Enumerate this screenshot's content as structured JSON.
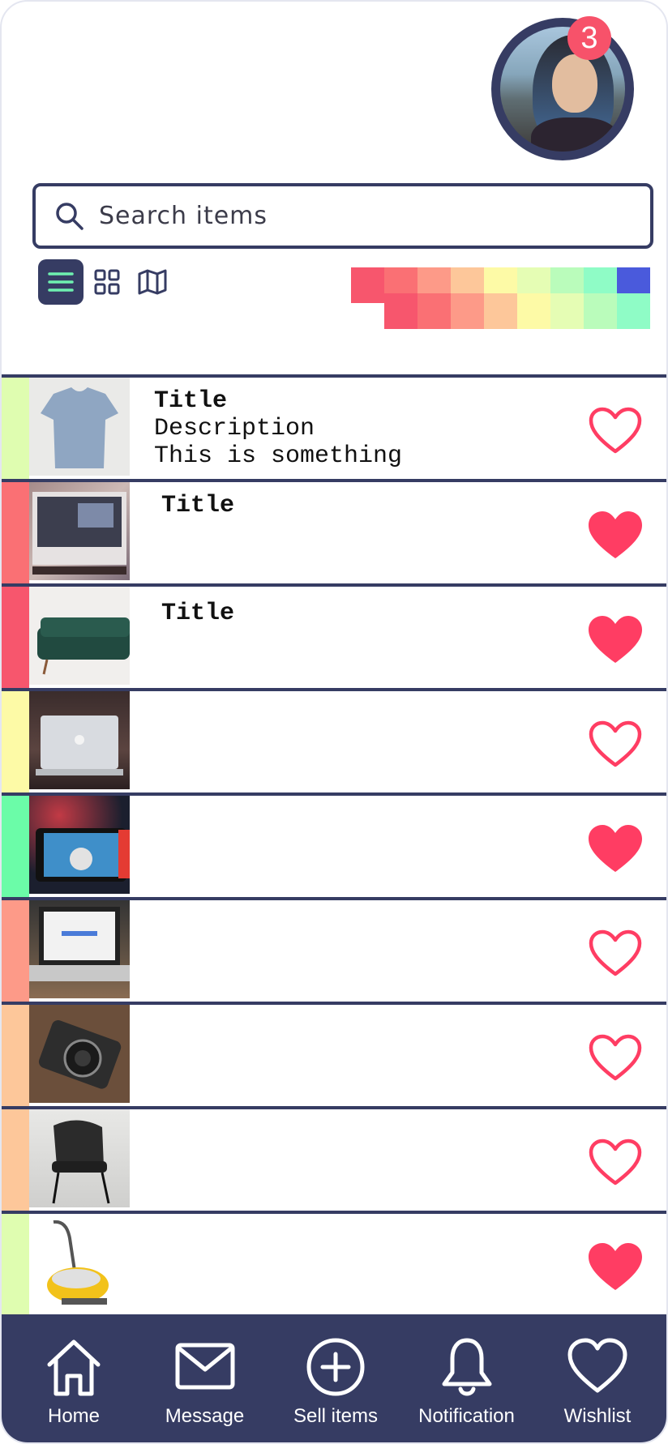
{
  "profile": {
    "notification_count": "3"
  },
  "search": {
    "placeholder": "Search items"
  },
  "view_modes": [
    "list",
    "grid",
    "map"
  ],
  "palette": {
    "row1": [
      "#f7566d",
      "#fa7074",
      "#fd9a88",
      "#fdc79a",
      "#fdfaa6",
      "#e5fdb4",
      "#bafcbb",
      "#8ffcc6",
      "#4a5adc"
    ],
    "row2": [
      "#f7566d",
      "#fa7074",
      "#fd9a88",
      "#fdc79a",
      "#fdfaa6",
      "#e5fdb4",
      "#bafcbb",
      "#8ffcc6"
    ]
  },
  "items": [
    {
      "title": "Title",
      "description": "Description",
      "extra": "This is something",
      "color": "#dffdb0",
      "liked": false,
      "image": "t-shirt"
    },
    {
      "title": "Title",
      "description": "",
      "extra": "",
      "color": "#fa7074",
      "liked": true,
      "image": "laptop-desk"
    },
    {
      "title": "Title",
      "description": "",
      "extra": "",
      "color": "#f7566d",
      "liked": true,
      "image": "green-sofa"
    },
    {
      "title": "",
      "description": "",
      "extra": "",
      "color": "#fdfaa6",
      "liked": false,
      "image": "macbook"
    },
    {
      "title": "",
      "description": "",
      "extra": "",
      "color": "#6bfca8",
      "liked": true,
      "image": "game-console"
    },
    {
      "title": "",
      "description": "",
      "extra": "",
      "color": "#fd9a88",
      "liked": false,
      "image": "laptop-google"
    },
    {
      "title": "",
      "description": "",
      "extra": "",
      "color": "#fdc79a",
      "liked": false,
      "image": "camera"
    },
    {
      "title": "",
      "description": "",
      "extra": "",
      "color": "#fdc79a",
      "liked": false,
      "image": "armchair"
    },
    {
      "title": "",
      "description": "",
      "extra": "",
      "color": "#dffdb0",
      "liked": true,
      "image": "vacuum"
    }
  ],
  "nav": {
    "home": "Home",
    "message": "Message",
    "sell": "Sell items",
    "notification": "Notification",
    "wishlist": "Wishlist"
  },
  "colors": {
    "primary": "#363c63",
    "accent": "#f7526a",
    "heart": "#ff3d63"
  }
}
